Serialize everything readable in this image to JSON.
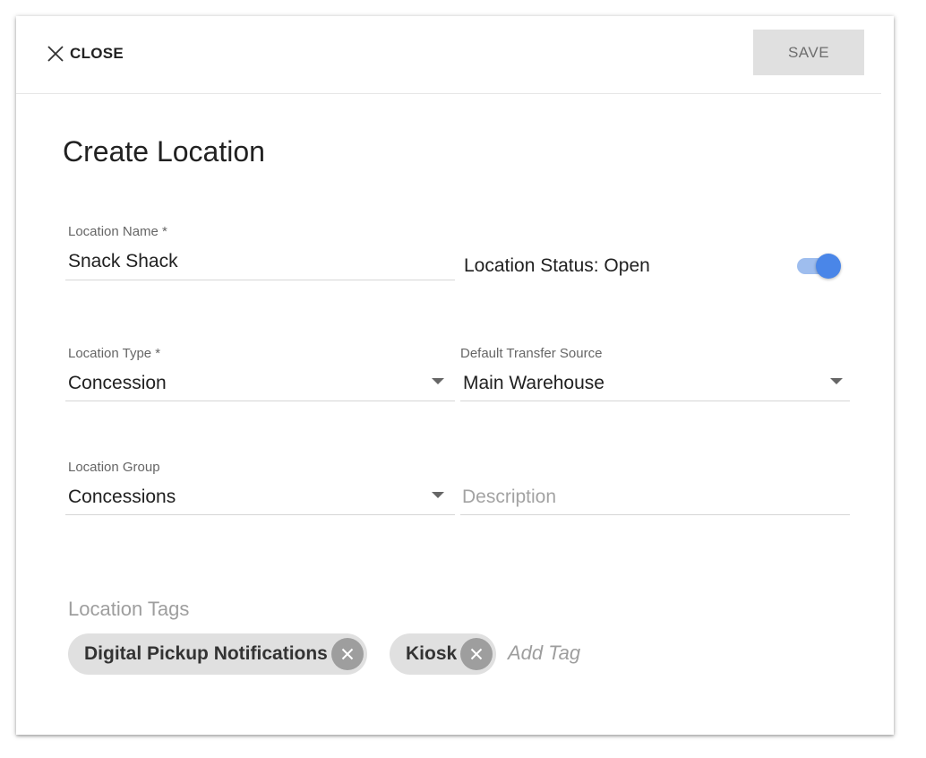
{
  "header": {
    "close_label": "CLOSE",
    "save_label": "SAVE"
  },
  "form": {
    "title": "Create Location",
    "location_name": {
      "label": "Location Name *",
      "value": "Snack Shack"
    },
    "location_status": {
      "label": "Location Status: Open",
      "enabled": true
    },
    "location_type": {
      "label": "Location Type *",
      "value": "Concession"
    },
    "default_transfer_source": {
      "label": "Default Transfer Source",
      "value": "Main Warehouse"
    },
    "location_group": {
      "label": "Location Group",
      "value": "Concessions"
    },
    "description": {
      "placeholder": "Description",
      "value": ""
    },
    "tags": {
      "label": "Location Tags",
      "items": [
        "Digital Pickup Notifications",
        "Kiosk"
      ],
      "add_placeholder": "Add Tag"
    }
  },
  "colors": {
    "accent": "#4a86e8",
    "accent_track": "#9ebdee",
    "chip_bg": "#e0e0e0",
    "chip_remove_bg": "#9e9e9e",
    "save_bg": "#e0e0e0"
  },
  "icons": {
    "close": "close-icon",
    "dropdown": "caret-down-icon",
    "chip_remove": "cancel-circle-icon"
  }
}
